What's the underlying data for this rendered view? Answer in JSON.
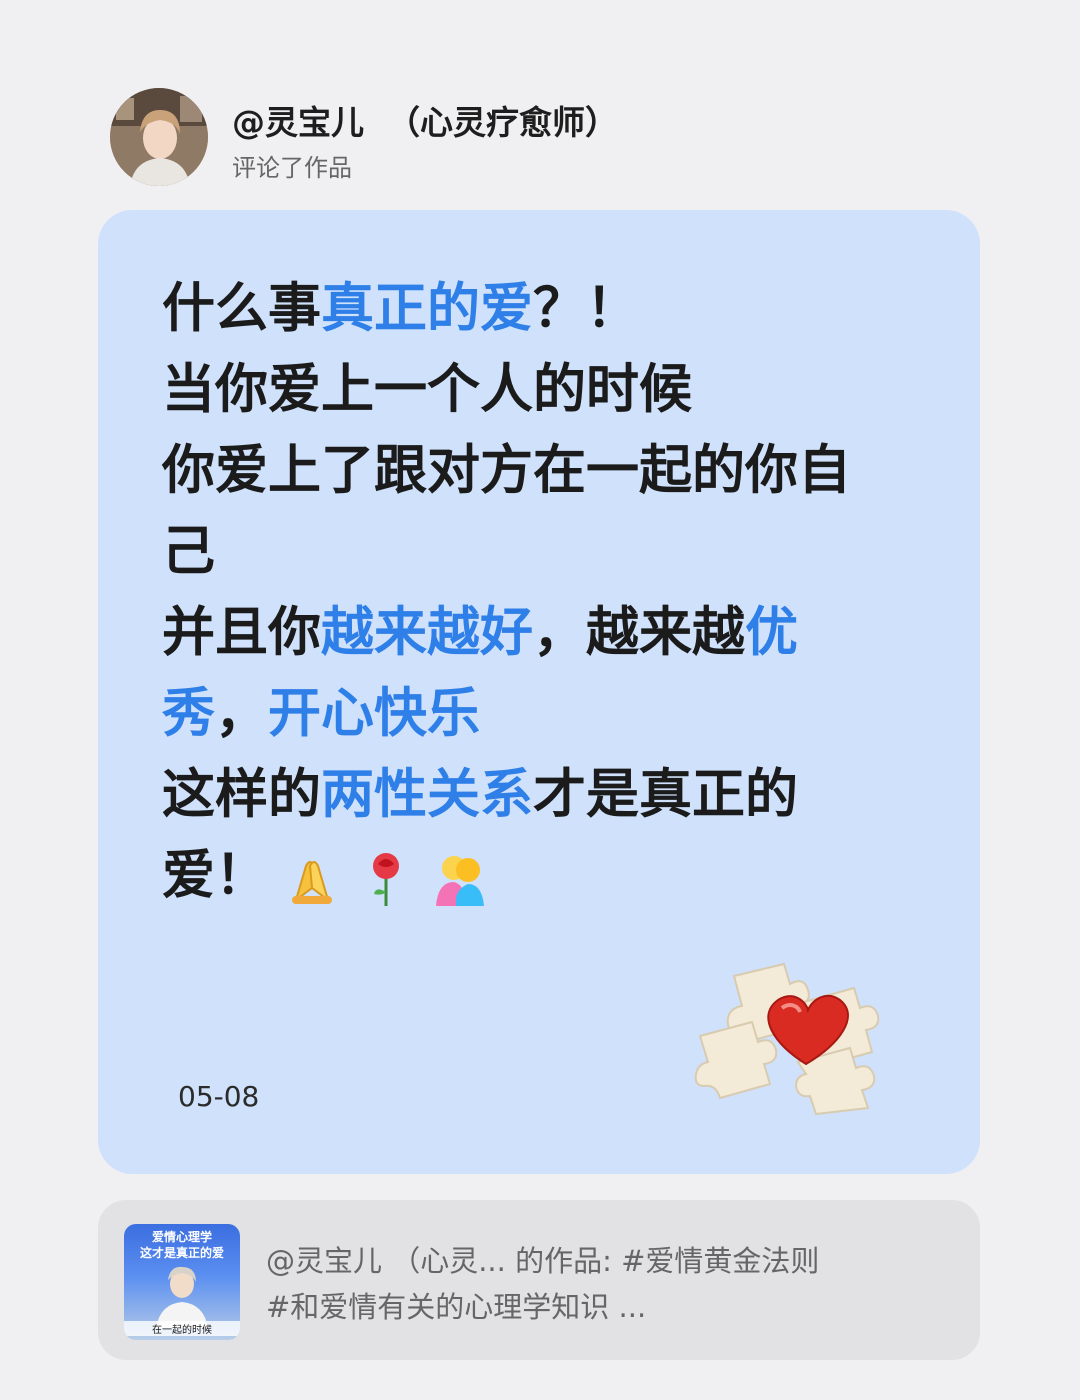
{
  "header": {
    "author": "@灵宝儿  （心灵疗愈师）",
    "subtitle": "评论了作品"
  },
  "comment": {
    "lines": [
      [
        {
          "t": "什么事"
        },
        {
          "t": "真正的爱",
          "hl": true
        },
        {
          "t": "？！"
        }
      ],
      [
        {
          "t": "当你爱上一个人的时候"
        }
      ],
      [
        {
          "t": "你爱上了跟对方在一起的你自"
        }
      ],
      [
        {
          "t": "己"
        }
      ],
      [
        {
          "t": "并且你"
        },
        {
          "t": "越来越好",
          "hl": true
        },
        {
          "t": "，越来越"
        },
        {
          "t": "优",
          "hl": true
        }
      ],
      [
        {
          "t": "秀",
          "hl": true
        },
        {
          "t": "，"
        },
        {
          "t": "开心快乐",
          "hl": true
        }
      ],
      [
        {
          "t": "这样的"
        },
        {
          "t": "两性关系",
          "hl": true
        },
        {
          "t": "才是真正的"
        }
      ],
      [
        {
          "t": "爱！"
        }
      ]
    ],
    "emojis": [
      "folded-hands-icon",
      "rose-icon",
      "hug-icon"
    ],
    "date": "05-08"
  },
  "quote": {
    "line1": "@灵宝儿  （心灵... 的作品: #爱情黄金法则",
    "line2": "#和爱情有关的心理学知识 ...",
    "thumb_title_1": "爱情心理学",
    "thumb_title_2": "这才是真正的爱",
    "thumb_caption": "在一起的时候"
  },
  "colors": {
    "highlight": "#2f7fe8",
    "card_bg": "#cfe1fb",
    "page_bg": "#f0f0f2",
    "quote_bg": "#e2e2e5"
  }
}
